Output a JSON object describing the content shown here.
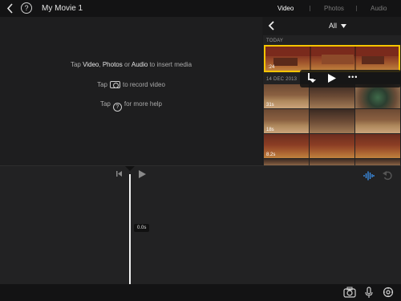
{
  "topbar": {
    "title": "My Movie 1",
    "help_label": "?",
    "tabs": [
      {
        "label": "Video",
        "active": true
      },
      {
        "label": "Photos",
        "active": false
      },
      {
        "label": "Audio",
        "active": false
      }
    ]
  },
  "viewer": {
    "hint_insert": {
      "prefix": "Tap ",
      "video": "Video",
      "sep1": ", ",
      "photos": "Photos",
      "sep2": " or ",
      "audio": "Audio",
      "suffix": " to insert media"
    },
    "hint_record": {
      "prefix": "Tap",
      "suffix": "to record video"
    },
    "hint_help": {
      "prefix": "Tap",
      "icon_label": "?",
      "suffix": "for more help"
    }
  },
  "browser": {
    "filter_label": "All",
    "sections": [
      {
        "label": "TODAY"
      },
      {
        "label": "14 DEC 2013"
      }
    ],
    "today_clip_duration": ":24",
    "dec_clips": [
      {
        "duration": "31s"
      },
      {
        "duration": "18s"
      },
      {
        "duration": "8.2s"
      }
    ],
    "clip_menu_more": "•••"
  },
  "timeline": {
    "playhead_time": "0.0s"
  },
  "colors": {
    "accent_selection": "#f5c400",
    "waveform_blue": "#3b8ee6",
    "background": "#1b1b1c"
  }
}
